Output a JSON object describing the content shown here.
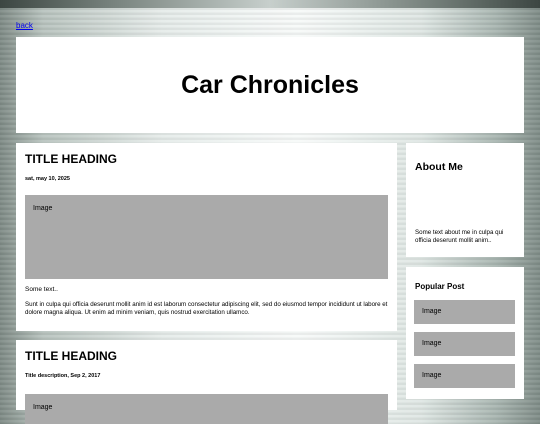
{
  "nav": {
    "back_label": "back"
  },
  "header": {
    "title": "Car Chronicles"
  },
  "posts": [
    {
      "title": "TITLE HEADING",
      "date": "sat, may 10, 2025",
      "image_label": "Image",
      "some_text": "Some text..",
      "body": "Sunt in culpa qui officia deserunt mollit anim id est laborum consectetur adipiscing elit, sed do eiusmod tempor incididunt ut labore et dolore magna aliqua. Ut enim ad minim veniam, quis nostrud exercitation ullamco."
    },
    {
      "title": "TITLE HEADING",
      "date": "Title description, Sep 2, 2017",
      "image_label": "Image"
    }
  ],
  "sidebar": {
    "about_title": "About Me",
    "about_text": "Some text about me in culpa qui officia deserunt mollit anim..",
    "popular_title": "Popular Post",
    "popular_items": [
      "Image",
      "Image",
      "Image"
    ]
  },
  "colors": {
    "image_placeholder": "#aaaaaa",
    "link": "#0000ee"
  }
}
